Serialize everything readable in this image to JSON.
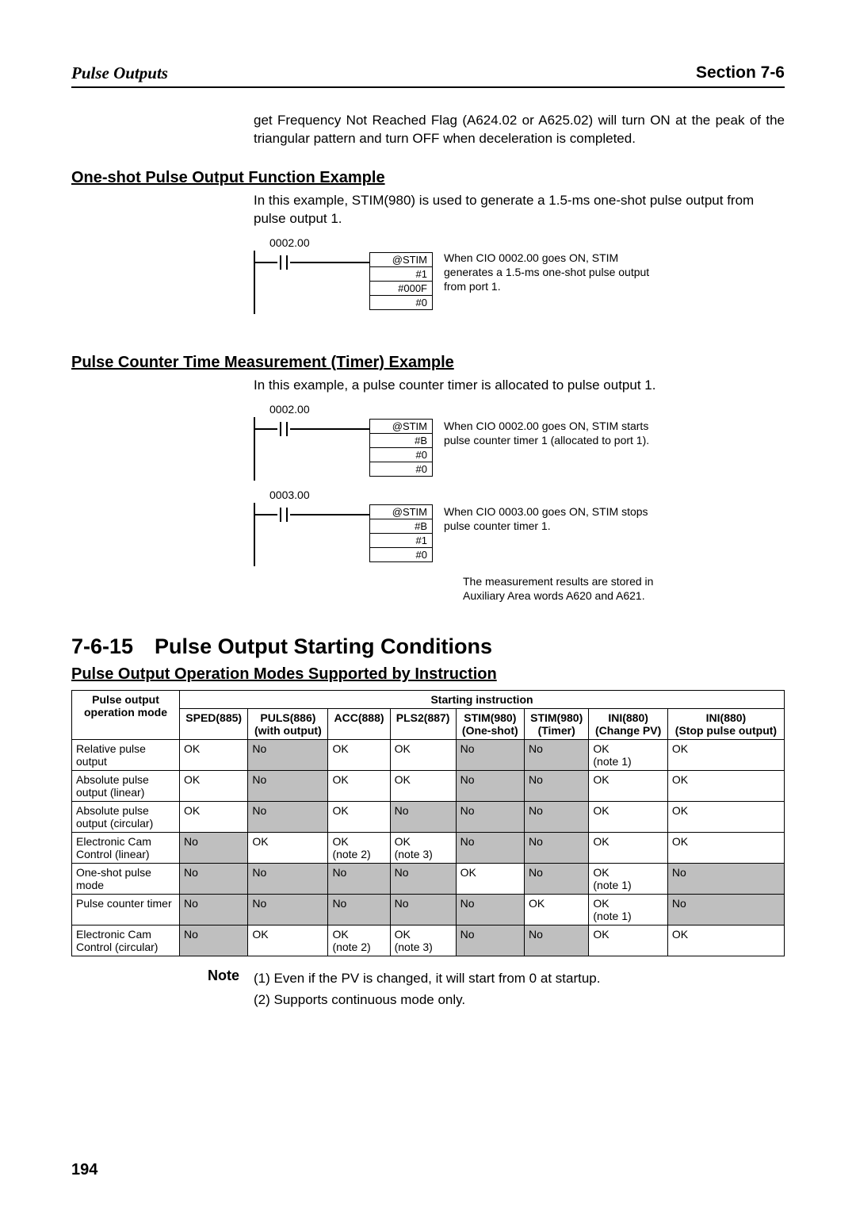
{
  "header": {
    "left": "Pulse Outputs",
    "right": "Section 7-6"
  },
  "intro": "get Frequency Not Reached Flag (A624.02 or A625.02) will turn ON at the peak of the triangular pattern and turn OFF when deceleration is completed.",
  "oneshot": {
    "heading": "One-shot Pulse Output Function Example",
    "text": "In this example, STIM(980) is used to generate a 1.5-ms one-shot pulse output from pulse output 1.",
    "contact": "0002.00",
    "block": [
      "@STIM",
      "#1",
      "#000F",
      "#0"
    ],
    "caption": "When CIO 0002.00 goes ON, STIM generates a 1.5-ms one-shot pulse output from port 1."
  },
  "timer": {
    "heading": "Pulse Counter Time Measurement (Timer) Example",
    "text": "In this example, a pulse counter timer is allocated to pulse output 1.",
    "rung1": {
      "contact": "0002.00",
      "block": [
        "@STIM",
        "#B",
        "#0",
        "#0"
      ],
      "caption": "When CIO 0002.00 goes ON, STIM starts pulse counter timer 1 (allocated to port 1)."
    },
    "rung2": {
      "contact": "0003.00",
      "block": [
        "@STIM",
        "#B",
        "#1",
        "#0"
      ],
      "caption": "When CIO 0003.00 goes ON, STIM stops pulse counter timer 1."
    },
    "meas": "The measurement results are stored in Auxiliary Area words A620 and A621."
  },
  "main_h": "7-6-15 Pulse Output Starting Conditions",
  "modes_h": "Pulse Output Operation Modes Supported by Instruction",
  "table": {
    "col0_header": "Pulse output operation mode",
    "starting_header": "Starting instruction",
    "cols": [
      "SPED(885)",
      "PULS(886) (with output)",
      "ACC(888)",
      "PLS2(887)",
      "STIM(980) (One-shot)",
      "STIM(980) (Timer)",
      "INI(880) (Change PV)",
      "INI(880) (Stop pulse output)"
    ],
    "rows": [
      {
        "name": "Relative pulse output",
        "c": [
          {
            "v": "OK"
          },
          {
            "v": "No",
            "no": true
          },
          {
            "v": "OK"
          },
          {
            "v": "OK"
          },
          {
            "v": "No",
            "no": true
          },
          {
            "v": "No",
            "no": true
          },
          {
            "v": "OK (note 1)"
          },
          {
            "v": "OK"
          }
        ]
      },
      {
        "name": "Absolute pulse output (linear)",
        "c": [
          {
            "v": "OK"
          },
          {
            "v": "No",
            "no": true
          },
          {
            "v": "OK"
          },
          {
            "v": "OK"
          },
          {
            "v": "No",
            "no": true
          },
          {
            "v": "No",
            "no": true
          },
          {
            "v": "OK"
          },
          {
            "v": "OK"
          }
        ]
      },
      {
        "name": "Absolute pulse output (circular)",
        "c": [
          {
            "v": "OK"
          },
          {
            "v": "No",
            "no": true
          },
          {
            "v": "OK"
          },
          {
            "v": "No",
            "no": true
          },
          {
            "v": "No",
            "no": true
          },
          {
            "v": "No",
            "no": true
          },
          {
            "v": "OK"
          },
          {
            "v": "OK"
          }
        ]
      },
      {
        "name": "Electronic Cam Control (linear)",
        "c": [
          {
            "v": "No",
            "no": true
          },
          {
            "v": "OK"
          },
          {
            "v": "OK (note 2)"
          },
          {
            "v": "OK (note 3)"
          },
          {
            "v": "No",
            "no": true
          },
          {
            "v": "No",
            "no": true
          },
          {
            "v": "OK"
          },
          {
            "v": "OK"
          }
        ]
      },
      {
        "name": "One-shot pulse mode",
        "c": [
          {
            "v": "No",
            "no": true
          },
          {
            "v": "No",
            "no": true
          },
          {
            "v": "No",
            "no": true
          },
          {
            "v": "No",
            "no": true
          },
          {
            "v": "OK"
          },
          {
            "v": "No",
            "no": true
          },
          {
            "v": "OK (note 1)"
          },
          {
            "v": "No",
            "no": true
          }
        ]
      },
      {
        "name": "Pulse counter timer",
        "c": [
          {
            "v": "No",
            "no": true
          },
          {
            "v": "No",
            "no": true
          },
          {
            "v": "No",
            "no": true
          },
          {
            "v": "No",
            "no": true
          },
          {
            "v": "No",
            "no": true
          },
          {
            "v": "OK"
          },
          {
            "v": "OK (note 1)"
          },
          {
            "v": "No",
            "no": true
          }
        ]
      },
      {
        "name": "Electronic Cam Control (circular)",
        "c": [
          {
            "v": "No",
            "no": true
          },
          {
            "v": "OK"
          },
          {
            "v": "OK (note 2)"
          },
          {
            "v": "OK (note 3)"
          },
          {
            "v": "No",
            "no": true
          },
          {
            "v": "No",
            "no": true
          },
          {
            "v": "OK"
          },
          {
            "v": "OK"
          }
        ]
      }
    ]
  },
  "notes": {
    "label": "Note",
    "items": [
      "(1) Even if the PV is changed, it will start from 0 at startup.",
      "(2) Supports continuous mode only."
    ]
  },
  "page_number": "194"
}
